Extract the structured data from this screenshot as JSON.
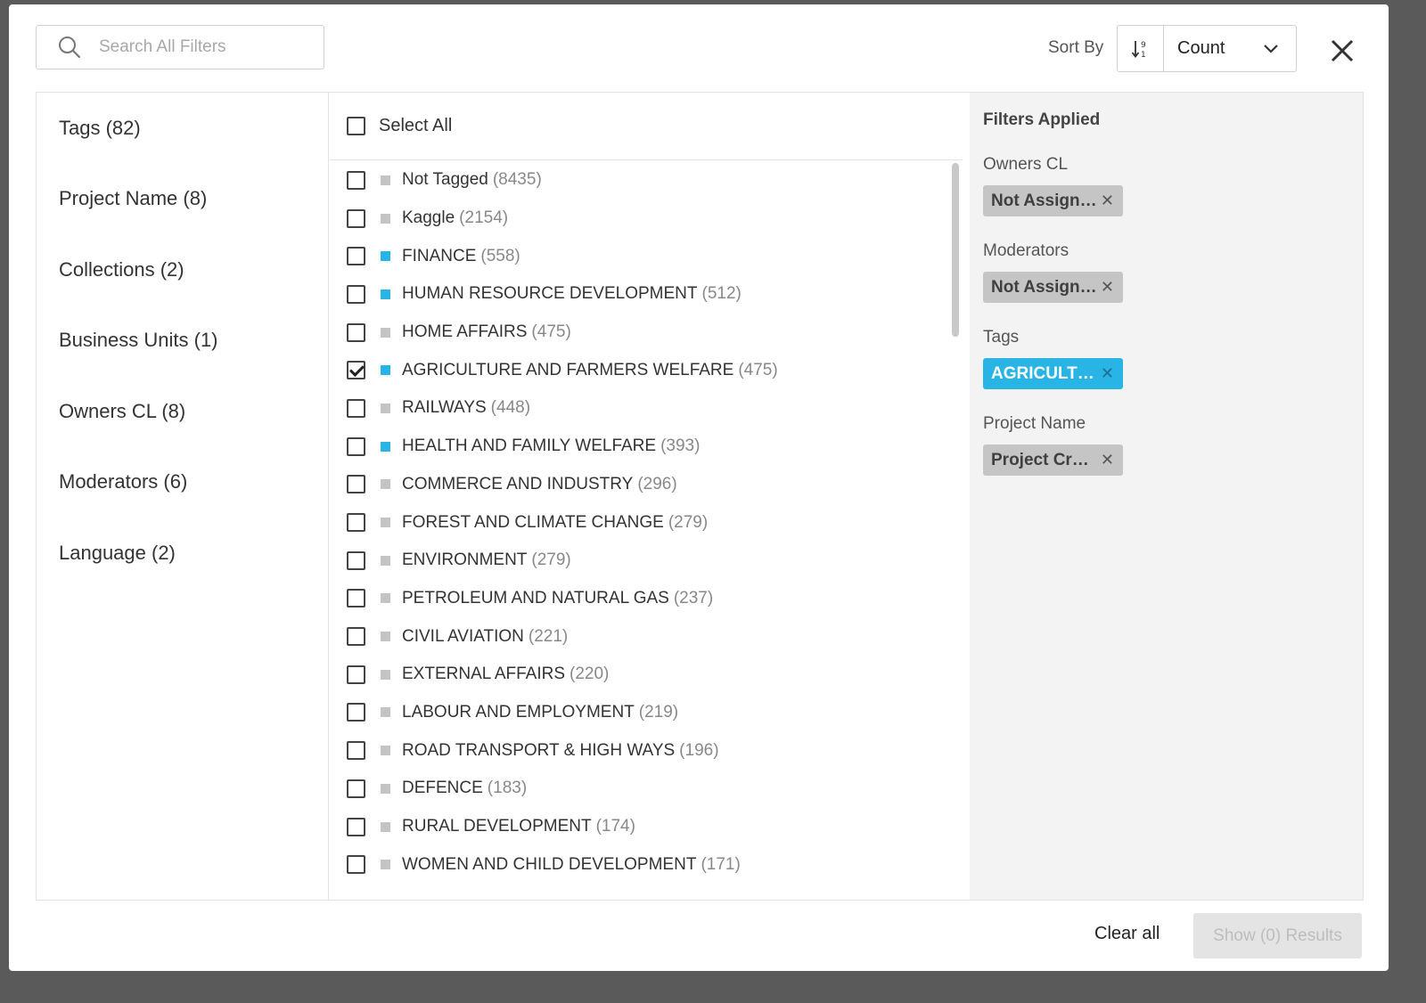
{
  "search": {
    "placeholder": "Search All Filters"
  },
  "sort": {
    "label": "Sort By",
    "value": "Count"
  },
  "categories": [
    {
      "label": "Tags (82)",
      "active": true
    },
    {
      "label": "Project Name (8)"
    },
    {
      "label": "Collections (2)"
    },
    {
      "label": "Business Units (1)"
    },
    {
      "label": "Owners CL (8)"
    },
    {
      "label": "Moderators (6)"
    },
    {
      "label": "Language (2)"
    }
  ],
  "select_all_label": "Select All",
  "colors": {
    "accent": "#29b4e6",
    "tag_grey": "#c4c4c4",
    "tag_blue": "#29b4e6",
    "active_category": "#e9f2d9"
  },
  "options": [
    {
      "name": "Not Tagged",
      "count": "(8435)",
      "color": "#c4c4c4",
      "checked": false
    },
    {
      "name": "Kaggle",
      "count": "(2154)",
      "color": "#c4c4c4",
      "checked": false
    },
    {
      "name": "FINANCE",
      "count": "(558)",
      "color": "#29b4e6",
      "checked": false
    },
    {
      "name": "HUMAN RESOURCE DEVELOPMENT",
      "count": "(512)",
      "color": "#29b4e6",
      "checked": false
    },
    {
      "name": "HOME AFFAIRS",
      "count": "(475)",
      "color": "#c4c4c4",
      "checked": false
    },
    {
      "name": "AGRICULTURE AND FARMERS WELFARE",
      "count": "(475)",
      "color": "#29b4e6",
      "checked": true
    },
    {
      "name": "RAILWAYS",
      "count": "(448)",
      "color": "#c4c4c4",
      "checked": false
    },
    {
      "name": "HEALTH AND FAMILY WELFARE",
      "count": "(393)",
      "color": "#29b4e6",
      "checked": false
    },
    {
      "name": "COMMERCE AND INDUSTRY",
      "count": "(296)",
      "color": "#c4c4c4",
      "checked": false
    },
    {
      "name": "FOREST AND CLIMATE CHANGE",
      "count": "(279)",
      "color": "#c4c4c4",
      "checked": false
    },
    {
      "name": "ENVIRONMENT",
      "count": "(279)",
      "color": "#c4c4c4",
      "checked": false
    },
    {
      "name": "PETROLEUM AND NATURAL GAS",
      "count": "(237)",
      "color": "#c4c4c4",
      "checked": false
    },
    {
      "name": "CIVIL AVIATION",
      "count": "(221)",
      "color": "#c4c4c4",
      "checked": false
    },
    {
      "name": "EXTERNAL AFFAIRS",
      "count": "(220)",
      "color": "#c4c4c4",
      "checked": false
    },
    {
      "name": "LABOUR AND EMPLOYMENT",
      "count": "(219)",
      "color": "#c4c4c4",
      "checked": false
    },
    {
      "name": "ROAD TRANSPORT & HIGH WAYS",
      "count": "(196)",
      "color": "#c4c4c4",
      "checked": false
    },
    {
      "name": "DEFENCE",
      "count": "(183)",
      "color": "#c4c4c4",
      "checked": false
    },
    {
      "name": "RURAL DEVELOPMENT",
      "count": "(174)",
      "color": "#c4c4c4",
      "checked": false
    },
    {
      "name": "WOMEN AND CHILD DEVELOPMENT",
      "count": "(171)",
      "color": "#c4c4c4",
      "checked": false
    }
  ],
  "applied": {
    "title": "Filters Applied",
    "groups": [
      {
        "title": "Owners CL",
        "chip": "Not Assign…",
        "accent": false
      },
      {
        "title": "Moderators",
        "chip": "Not Assign…",
        "accent": false
      },
      {
        "title": "Tags",
        "chip": "AGRICULT…",
        "accent": true
      },
      {
        "title": "Project Name",
        "chip": "Project Cr…",
        "accent": false
      }
    ]
  },
  "footer": {
    "clear_all": "Clear all",
    "show_results": "Show (0) Results"
  }
}
